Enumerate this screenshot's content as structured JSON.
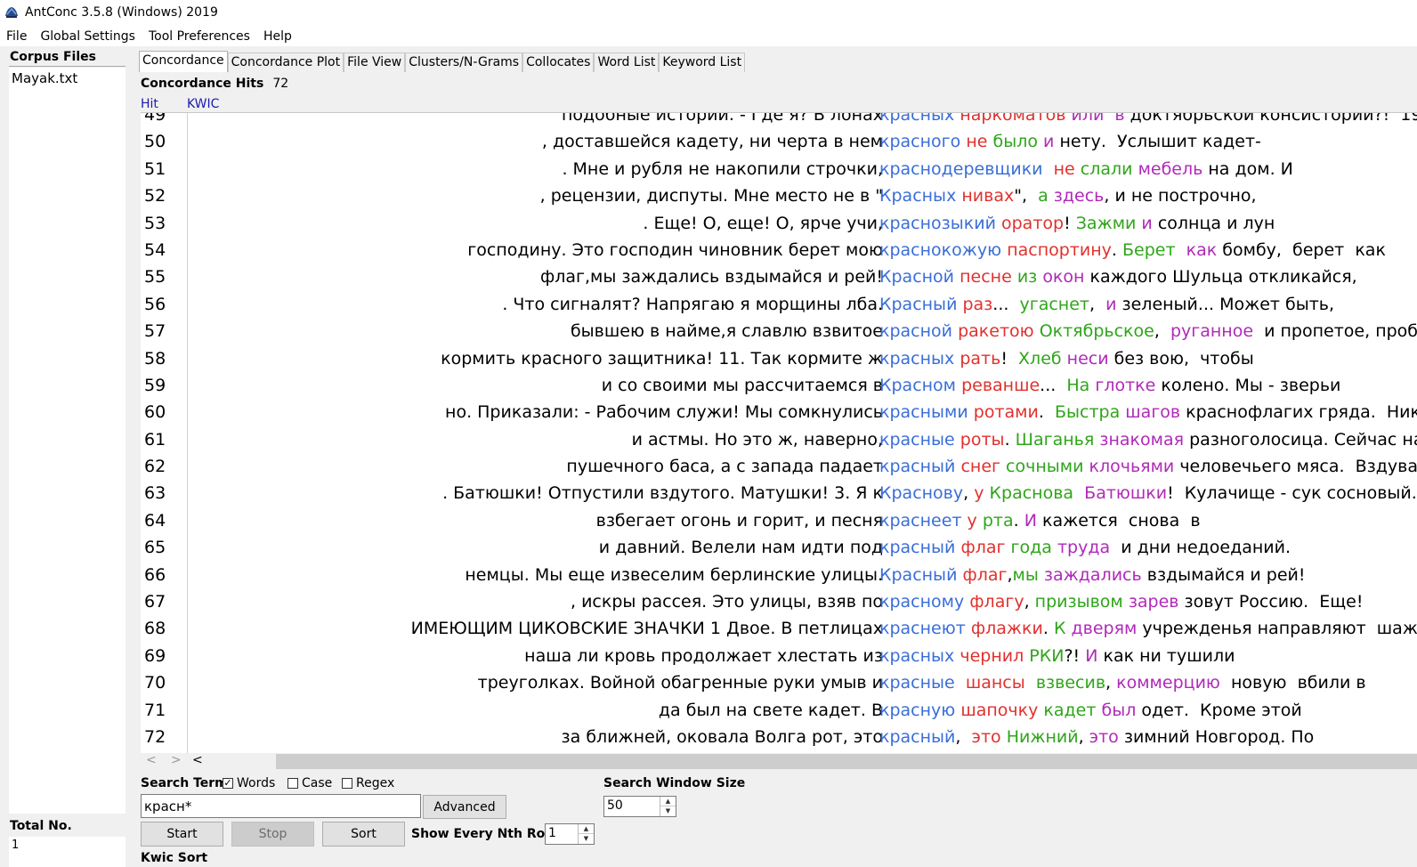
{
  "window": {
    "title": "AntConc 3.5.8 (Windows) 2019"
  },
  "menu": [
    "File",
    "Global Settings",
    "Tool Preferences",
    "Help"
  ],
  "sidebar": {
    "header": "Corpus Files",
    "files": [
      "Mayak.txt"
    ],
    "total_label": "Total No.",
    "total_value": "1"
  },
  "tabs": [
    "Concordance",
    "Concordance Plot",
    "File View",
    "Clusters/N-Grams",
    "Collocates",
    "Word List",
    "Keyword List"
  ],
  "active_tab": "Concordance",
  "hits": {
    "label": "Concordance Hits",
    "value": "72"
  },
  "columns": {
    "hit": "Hit",
    "kwic": "KWIC"
  },
  "colors": {
    "keyword": "#3a6ed8",
    "level1": "#e0312e",
    "level2": "#2fa51a",
    "level3": "#b02ab8"
  },
  "rows": [
    {
      "num": "49",
      "left": "подобные истории. - Где я?  В лонах",
      "kwic": [
        [
          "kw",
          "красных"
        ],
        [
          "blk",
          " "
        ],
        [
          "c1",
          "наркоматов"
        ],
        [
          "blk",
          " "
        ],
        [
          "c3",
          "или"
        ],
        [
          "blk",
          "  "
        ],
        [
          "c3",
          "в"
        ],
        [
          "blk",
          " доктябрьской консистории?!  19"
        ]
      ]
    },
    {
      "num": "50",
      "left": ", доставшейся кадету, ни черта в нем",
      "kwic": [
        [
          "kw",
          "красного"
        ],
        [
          "blk",
          " "
        ],
        [
          "c1",
          "не"
        ],
        [
          "blk",
          " "
        ],
        [
          "c2",
          "было"
        ],
        [
          "blk",
          " "
        ],
        [
          "c3",
          "и"
        ],
        [
          "blk",
          " нету.  Услышит кадет-"
        ]
      ]
    },
    {
      "num": "51",
      "left": ". Мне  и рубля  не накопили строчки,",
      "kwic": [
        [
          "kw",
          "краснодеревщики"
        ],
        [
          "blk",
          "  "
        ],
        [
          "c1",
          "не"
        ],
        [
          "blk",
          " "
        ],
        [
          "c2",
          "слали"
        ],
        [
          "blk",
          " "
        ],
        [
          "c3",
          "мебель"
        ],
        [
          "blk",
          " на дом. И"
        ]
      ]
    },
    {
      "num": "52",
      "left": ",  рецензии,  диспуты. Мне место  не в \"",
      "kwic": [
        [
          "kw",
          "Красных"
        ],
        [
          "blk",
          " "
        ],
        [
          "c1",
          "нивах"
        ],
        [
          "blk",
          "\",  "
        ],
        [
          "c2",
          "а"
        ],
        [
          "blk",
          " "
        ],
        [
          "c3",
          "здесь"
        ],
        [
          "blk",
          ", и не построчно,"
        ]
      ]
    },
    {
      "num": "53",
      "left": ".  Еще! О, еще! О, ярче учи,",
      "kwic": [
        [
          "kw",
          "краснозыкий"
        ],
        [
          "blk",
          " "
        ],
        [
          "c1",
          "оратор"
        ],
        [
          "blk",
          "! "
        ],
        [
          "c2",
          "Зажми"
        ],
        [
          "blk",
          " "
        ],
        [
          "c3",
          "и"
        ],
        [
          "blk",
          " солнца и лун"
        ]
      ]
    },
    {
      "num": "54",
      "left": "господину. Это  господин чиновник  берет мою",
      "kwic": [
        [
          "kw",
          "краснокожую"
        ],
        [
          "blk",
          " "
        ],
        [
          "c1",
          "паспортину"
        ],
        [
          "blk",
          ". "
        ],
        [
          "c2",
          "Берет"
        ],
        [
          "blk",
          "  "
        ],
        [
          "c3",
          "как"
        ],
        [
          "blk",
          " бомбу,  берет  как"
        ]
      ]
    },
    {
      "num": "55",
      "left": "флаг,мы заждались вздымайся и рей!",
      "kwic": [
        [
          "kw",
          "Красной"
        ],
        [
          "blk",
          " "
        ],
        [
          "c1",
          "песне"
        ],
        [
          "blk",
          " "
        ],
        [
          "c2",
          "из"
        ],
        [
          "blk",
          " "
        ],
        [
          "c3",
          "окон"
        ],
        [
          "blk",
          " каждого Шульца откликайся,"
        ]
      ]
    },
    {
      "num": "56",
      "left": ". Что сигналят?  Напрягаю я  морщины лба.",
      "kwic": [
        [
          "kw",
          "Красный"
        ],
        [
          "blk",
          " "
        ],
        [
          "c1",
          "раз"
        ],
        [
          "blk",
          "...  "
        ],
        [
          "c2",
          "угаснет"
        ],
        [
          "blk",
          ",  "
        ],
        [
          "c3",
          "и"
        ],
        [
          "blk",
          " зеленый... Может быть,"
        ]
      ]
    },
    {
      "num": "57",
      "left": "бывшею в найме,я славлю  взвитое",
      "kwic": [
        [
          "kw",
          "красной"
        ],
        [
          "blk",
          " "
        ],
        [
          "c1",
          "ракетою"
        ],
        [
          "blk",
          " "
        ],
        [
          "c2",
          "Октябрьское"
        ],
        [
          "blk",
          ",  "
        ],
        [
          "c3",
          "руганное"
        ],
        [
          "blk",
          "  и пропетое, проби"
        ]
      ]
    },
    {
      "num": "58",
      "left": "кормить  красного защитника! 11. Так кормите ж",
      "kwic": [
        [
          "kw",
          "красных"
        ],
        [
          "blk",
          " "
        ],
        [
          "c1",
          "рать"
        ],
        [
          "blk",
          "!  "
        ],
        [
          "c2",
          "Хлеб"
        ],
        [
          "blk",
          " "
        ],
        [
          "c3",
          "неси"
        ],
        [
          "blk",
          " без вою,  чтобы"
        ]
      ]
    },
    {
      "num": "59",
      "left": "и со своими мы рассчитаемся в",
      "kwic": [
        [
          "kw",
          "Красном"
        ],
        [
          "blk",
          " "
        ],
        [
          "c1",
          "реванше"
        ],
        [
          "blk",
          "...  "
        ],
        [
          "c2",
          "На"
        ],
        [
          "blk",
          " "
        ],
        [
          "c3",
          "глотке"
        ],
        [
          "blk",
          " колено. Мы - зверьи"
        ]
      ]
    },
    {
      "num": "60",
      "left": "но.  Приказали:  - Рабочим служи!  Мы  сомкнулись",
      "kwic": [
        [
          "kw",
          "красными"
        ],
        [
          "blk",
          " "
        ],
        [
          "c1",
          "ротами"
        ],
        [
          "blk",
          ".  "
        ],
        [
          "c2",
          "Быстра"
        ],
        [
          "blk",
          " "
        ],
        [
          "c3",
          "шагов"
        ],
        [
          "blk",
          " краснофлагих гряда.  Никако"
        ]
      ]
    },
    {
      "num": "61",
      "left": "и астмы. Но это ж,  наверно,",
      "kwic": [
        [
          "kw",
          "красные"
        ],
        [
          "blk",
          " "
        ],
        [
          "c1",
          "роты"
        ],
        [
          "blk",
          ". "
        ],
        [
          "c2",
          "Шаганья"
        ],
        [
          "blk",
          " "
        ],
        [
          "c3",
          "знакомая"
        ],
        [
          "blk",
          " разноголосица. Сейчас на"
        ]
      ]
    },
    {
      "num": "62",
      "left": "пушечного баса, а с запада падает",
      "kwic": [
        [
          "kw",
          "красный"
        ],
        [
          "blk",
          " "
        ],
        [
          "c1",
          "снег"
        ],
        [
          "blk",
          " "
        ],
        [
          "c2",
          "сочными"
        ],
        [
          "blk",
          " "
        ],
        [
          "c3",
          "клочьями"
        ],
        [
          "blk",
          " человечьего мяса.  Вздувает"
        ]
      ]
    },
    {
      "num": "63",
      "left": ".  Батюшки!  Отпустили вздутого.  Матушки! 3. Я к",
      "kwic": [
        [
          "kw",
          "Краснову"
        ],
        [
          "blk",
          ", "
        ],
        [
          "c1",
          "у"
        ],
        [
          "blk",
          " "
        ],
        [
          "c2",
          "Краснова"
        ],
        [
          "blk",
          "  "
        ],
        [
          "c3",
          "Батюшки"
        ],
        [
          "blk",
          "!  Кулачище - сук сосновый."
        ]
      ]
    },
    {
      "num": "64",
      "left": "взбегает огонь  и горит, и песня",
      "kwic": [
        [
          "kw",
          "краснеет"
        ],
        [
          "blk",
          " "
        ],
        [
          "c1",
          "у"
        ],
        [
          "blk",
          " "
        ],
        [
          "c2",
          "рта"
        ],
        [
          "blk",
          ". "
        ],
        [
          "c3",
          "И"
        ],
        [
          "blk",
          " кажется  снова  в"
        ]
      ]
    },
    {
      "num": "65",
      "left": "и давний. Велели нам  идти  под",
      "kwic": [
        [
          "kw",
          "красный"
        ],
        [
          "blk",
          " "
        ],
        [
          "c1",
          "флаг"
        ],
        [
          "blk",
          " "
        ],
        [
          "c2",
          "года"
        ],
        [
          "blk",
          " "
        ],
        [
          "c3",
          "труда"
        ],
        [
          "blk",
          "  и дни недоеданий."
        ]
      ]
    },
    {
      "num": "66",
      "left": "немцы. Мы еще извеселим берлинские улицы.",
      "kwic": [
        [
          "kw",
          "Красный"
        ],
        [
          "blk",
          " "
        ],
        [
          "c1",
          "флаг"
        ],
        [
          "blk",
          ","
        ],
        [
          "c2",
          "мы"
        ],
        [
          "blk",
          " "
        ],
        [
          "c3",
          "заждались"
        ],
        [
          "blk",
          " вздымайся и рей!"
        ]
      ]
    },
    {
      "num": "67",
      "left": ", искры рассея. Это улицы, взяв по",
      "kwic": [
        [
          "kw",
          "красному"
        ],
        [
          "blk",
          " "
        ],
        [
          "c1",
          "флагу"
        ],
        [
          "blk",
          ", "
        ],
        [
          "c2",
          "призывом"
        ],
        [
          "blk",
          " "
        ],
        [
          "c3",
          "зарев"
        ],
        [
          "blk",
          " зовут Россию.  Еще!"
        ]
      ]
    },
    {
      "num": "68",
      "left": "ИМЕЮЩИМ ЦИКОВСКИЕ  ЗНАЧКИ  1  Двое.  В петлицах",
      "kwic": [
        [
          "kw",
          "краснеют"
        ],
        [
          "blk",
          " "
        ],
        [
          "c1",
          "флажки"
        ],
        [
          "blk",
          ". "
        ],
        [
          "c2",
          "К"
        ],
        [
          "blk",
          " "
        ],
        [
          "c3",
          "дверям"
        ],
        [
          "blk",
          " учрежденья направляют  шажки..."
        ]
      ]
    },
    {
      "num": "69",
      "left": "наша ли кровь  продолжает хлестать из",
      "kwic": [
        [
          "kw",
          "красных"
        ],
        [
          "blk",
          " "
        ],
        [
          "c1",
          "чернил"
        ],
        [
          "blk",
          " "
        ],
        [
          "c2",
          "РКИ"
        ],
        [
          "blk",
          "?! "
        ],
        [
          "c3",
          "И"
        ],
        [
          "blk",
          " как ни тушили"
        ]
      ]
    },
    {
      "num": "70",
      "left": "треуголках. Войной обагренные  руки  умыв и",
      "kwic": [
        [
          "kw",
          "красные"
        ],
        [
          "blk",
          "  "
        ],
        [
          "c1",
          "шансы"
        ],
        [
          "blk",
          "  "
        ],
        [
          "c2",
          "взвесив"
        ],
        [
          "blk",
          ", "
        ],
        [
          "c3",
          "коммерцию"
        ],
        [
          "blk",
          "  новую  вбили в"
        ]
      ]
    },
    {
      "num": "71",
      "left": "да был на свете кадет. В",
      "kwic": [
        [
          "kw",
          "красную"
        ],
        [
          "blk",
          " "
        ],
        [
          "c1",
          "шапочку"
        ],
        [
          "blk",
          " "
        ],
        [
          "c2",
          "кадет"
        ],
        [
          "blk",
          " "
        ],
        [
          "c3",
          "был"
        ],
        [
          "blk",
          " одет.  Кроме этой"
        ]
      ]
    },
    {
      "num": "72",
      "left": "за ближней, оковала Волга рот, это",
      "kwic": [
        [
          "kw",
          "красный"
        ],
        [
          "blk",
          ",  "
        ],
        [
          "c1",
          "это"
        ],
        [
          "blk",
          " "
        ],
        [
          "c2",
          "Нижний"
        ],
        [
          "blk",
          ", "
        ],
        [
          "c3",
          "это"
        ],
        [
          "blk",
          " зимний Новгород. По"
        ]
      ]
    }
  ],
  "search": {
    "term_label": "Search Term",
    "options": [
      {
        "label": "Words",
        "checked": true
      },
      {
        "label": "Case",
        "checked": false
      },
      {
        "label": "Regex",
        "checked": false
      }
    ],
    "check_mark": "✓",
    "term_value": "красн*",
    "advanced_label": "Advanced",
    "window_size_label": "Search Window Size",
    "window_size_value": "50",
    "start_label": "Start",
    "stop_label": "Stop",
    "sort_label": "Sort",
    "nth_label": "Show Every Nth Row",
    "nth_value": "1",
    "kwic_sort_label": "Kwic Sort"
  }
}
